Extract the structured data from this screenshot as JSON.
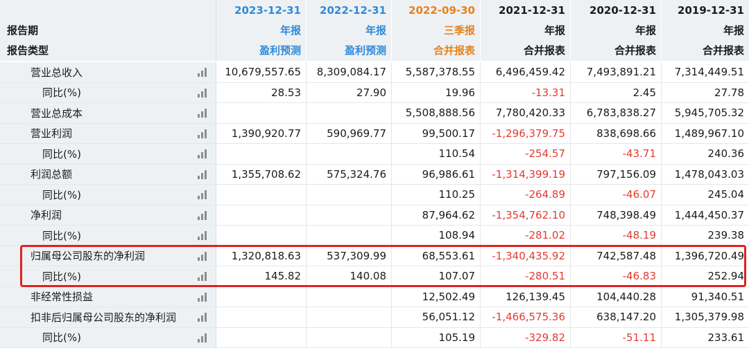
{
  "header": {
    "label_row1": "",
    "label_row2": "报告期",
    "label_row3": "报告类型",
    "columns": [
      {
        "date": "2023-12-31",
        "period": "年报",
        "type": "盈利预测",
        "color": "#2f8ad8"
      },
      {
        "date": "2022-12-31",
        "period": "年报",
        "type": "盈利预测",
        "color": "#2f8ad8"
      },
      {
        "date": "2022-09-30",
        "period": "三季报",
        "type": "合并报表",
        "color": "#e8811a"
      },
      {
        "date": "2021-12-31",
        "period": "年报",
        "type": "合并报表",
        "color": "#1a1a1a"
      },
      {
        "date": "2020-12-31",
        "period": "年报",
        "type": "合并报表",
        "color": "#1a1a1a"
      },
      {
        "date": "2019-12-31",
        "period": "年报",
        "type": "合并报表",
        "color": "#1a1a1a"
      }
    ]
  },
  "rows": [
    {
      "label": "营业总收入",
      "level": 1,
      "values": [
        "10,679,557.65",
        "8,309,084.17",
        "5,587,378.55",
        "6,496,459.42",
        "7,493,891.21",
        "7,314,449.51"
      ]
    },
    {
      "label": "同比(%)",
      "level": 2,
      "values": [
        "28.53",
        "27.90",
        "19.96",
        "-13.31",
        "2.45",
        "27.78"
      ]
    },
    {
      "label": "营业总成本",
      "level": 1,
      "values": [
        "",
        "",
        "5,508,888.56",
        "7,780,420.33",
        "6,783,838.27",
        "5,945,705.32"
      ]
    },
    {
      "label": "营业利润",
      "level": 1,
      "values": [
        "1,390,920.77",
        "590,969.77",
        "99,500.17",
        "-1,296,379.75",
        "838,698.66",
        "1,489,967.10"
      ]
    },
    {
      "label": "同比(%)",
      "level": 2,
      "values": [
        "",
        "",
        "110.54",
        "-254.57",
        "-43.71",
        "240.36"
      ]
    },
    {
      "label": "利润总额",
      "level": 1,
      "values": [
        "1,355,708.62",
        "575,324.76",
        "96,986.61",
        "-1,314,399.19",
        "797,156.09",
        "1,478,043.03"
      ]
    },
    {
      "label": "同比(%)",
      "level": 2,
      "values": [
        "",
        "",
        "110.25",
        "-264.89",
        "-46.07",
        "245.04"
      ]
    },
    {
      "label": "净利润",
      "level": 1,
      "values": [
        "",
        "",
        "87,964.62",
        "-1,354,762.10",
        "748,398.49",
        "1,444,450.37"
      ]
    },
    {
      "label": "同比(%)",
      "level": 2,
      "values": [
        "",
        "",
        "108.94",
        "-281.02",
        "-48.19",
        "239.38"
      ]
    },
    {
      "label": "归属母公司股东的净利润",
      "level": 1,
      "values": [
        "1,320,818.63",
        "537,309.99",
        "68,553.61",
        "-1,340,435.92",
        "742,587.48",
        "1,396,720.49"
      ]
    },
    {
      "label": "同比(%)",
      "level": 2,
      "values": [
        "145.82",
        "140.08",
        "107.07",
        "-280.51",
        "-46.83",
        "252.94"
      ]
    },
    {
      "label": "非经常性损益",
      "level": 1,
      "values": [
        "",
        "",
        "12,502.49",
        "126,139.45",
        "104,440.28",
        "91,340.51"
      ]
    },
    {
      "label": "扣非后归属母公司股东的净利润",
      "level": 1,
      "values": [
        "",
        "",
        "56,051.12",
        "-1,466,575.36",
        "638,147.20",
        "1,305,379.98"
      ]
    },
    {
      "label": "同比(%)",
      "level": 2,
      "values": [
        "",
        "",
        "105.19",
        "-329.82",
        "-51.11",
        "233.61"
      ]
    }
  ],
  "highlight_color": "#e02020",
  "negative_color": "#e03b30",
  "icon": "bar-chart-icon"
}
